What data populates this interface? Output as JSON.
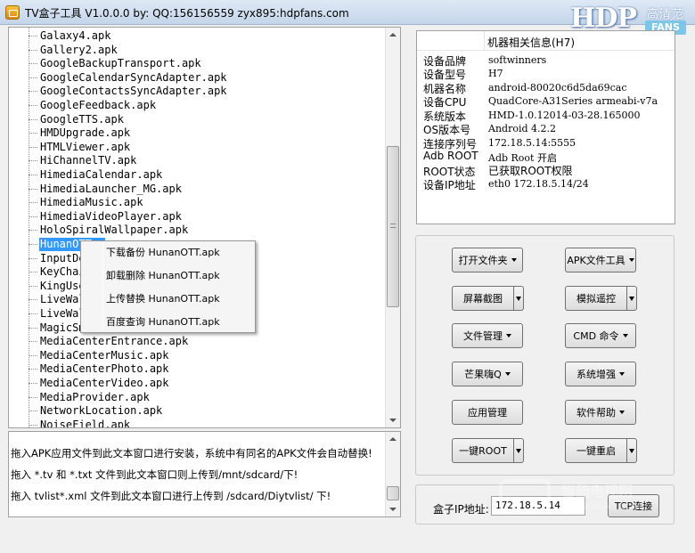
{
  "window": {
    "title": "TV盒子工具 V1.0.0.0 by: QQ:156156559  zyx895:hdpfans.com",
    "logo": {
      "brand": "HDP",
      "cn": "高清范",
      "fans": "FANS"
    }
  },
  "app_list": {
    "items": [
      "Galaxy4.apk",
      "Gallery2.apk",
      "GoogleBackupTransport.apk",
      "GoogleCalendarSyncAdapter.apk",
      "GoogleContactsSyncAdapter.apk",
      "GoogleFeedback.apk",
      "GoogleTTS.apk",
      "HMDUpgrade.apk",
      "HTMLViewer.apk",
      "HiChannelTV.apk",
      "HimediaCalendar.apk",
      "HimediaLauncher_MG.apk",
      "HimediaMusic.apk",
      "HimediaVideoPlayer.apk",
      "HoloSpiralWallpaper.apk",
      "HunanOTT.apk",
      "InputDe",
      "KeyChai",
      "KingUse",
      "LiveWal",
      "LiveWal",
      "MagicSm",
      "MediaCenterEntrance.apk",
      "MediaCenterMusic.apk",
      "MediaCenterPhoto.apk",
      "MediaCenterVideo.apk",
      "MediaProvider.apk",
      "NetworkLocation.apk",
      "NoiseField.apk"
    ],
    "selected_index": 15,
    "selected_visible_text": "HunanOTT.a"
  },
  "context_menu": {
    "items": [
      "下载备份 HunanOTT.apk",
      "卸载删除 HunanOTT.apk",
      "上传替换 HunanOTT.apk",
      "百度查询 HunanOTT.apk"
    ]
  },
  "log": {
    "lines": [
      "拖入APK应用文件到此文本窗口进行安装，系统中有同名的APK文件会自动替换!",
      "拖入 *.tv 和 *.txt 文件到此文本窗口则上传到/mnt/sdcard/下!",
      "拖入 tvlist*.xml 文件到此文本窗口进行上传到 /sdcard/Diytvlist/ 下!"
    ]
  },
  "device_info": {
    "header": "机器相关信息(H7)",
    "rows": [
      {
        "key": "设备品牌",
        "value": "softwinners"
      },
      {
        "key": "设备型号",
        "value": "H7"
      },
      {
        "key": "机器名称",
        "value": "android-80020c6d5da69cac"
      },
      {
        "key": "设备CPU",
        "value": "QuadCore-A31Series  armeabi-v7a"
      },
      {
        "key": "系统版本",
        "value": "HMD-1.0.12014-03-28.165000"
      },
      {
        "key": "OS版本号",
        "value": "Android  4.2.2"
      },
      {
        "key": "连接序列号",
        "value": "172.18.5.14:5555"
      },
      {
        "key": "Adb ROOT",
        "value": "Adb Root 开启"
      },
      {
        "key": "ROOT状态",
        "value": "已获取ROOT权限"
      },
      {
        "key": "设备IP地址",
        "value": "eth0 172.18.5.14/24"
      }
    ]
  },
  "buttons": {
    "open_folder": "打开文件夹",
    "apk_tools": "APK文件工具",
    "screenshot": "屏幕截图",
    "remote_sim": "模拟遥控",
    "file_mgr": "文件管理",
    "cmd": "CMD 命令",
    "mango": "芒果嗨Q",
    "sys_enhance": "系统增强",
    "app_mgr": "应用管理",
    "help": "软件帮助",
    "one_root": "一键ROOT",
    "one_reboot": "一键重启"
  },
  "ip": {
    "label": "盒子IP地址:",
    "value": "172.18.5.14",
    "connect": "TCP连接"
  },
  "watermark": {
    "text": "智能电视网",
    "sub": "TVSDFANS.COM"
  }
}
